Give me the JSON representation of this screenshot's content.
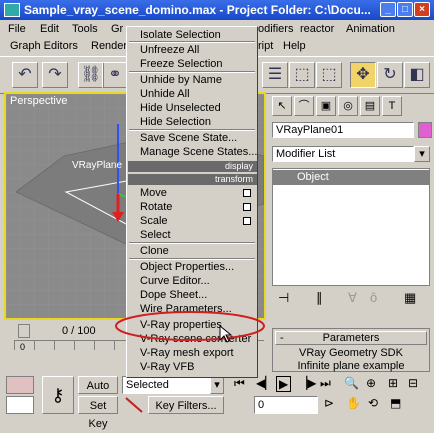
{
  "window": {
    "title": "Sample_vray_scene_domino.max   - Project Folder: C:\\Docu...",
    "minimize": "_",
    "maximize": "□",
    "close": "×"
  },
  "menubar1": [
    "File",
    "Edit",
    "Tools",
    "Gr",
    "odifiers",
    "reactor",
    "Animation"
  ],
  "menubar2": [
    "Graph Editors",
    "Render",
    "ript",
    "Help"
  ],
  "viewport": {
    "label": "Perspective",
    "object_label": "VRayPlane"
  },
  "context_menu": {
    "items_top": [
      "Isolate Selection",
      "Unfreeze All",
      "Freeze Selection"
    ],
    "items_mid": [
      "Unhide by Name",
      "Unhide All",
      "Hide Unselected",
      "Hide Selection"
    ],
    "items_scene": [
      "Save Scene State...",
      "Manage Scene States..."
    ],
    "header_display": "display",
    "header_transform": "transform",
    "transform_items": [
      "Move",
      "Rotate",
      "Scale",
      "Select"
    ],
    "clone": "Clone",
    "object_items": [
      "Object Properties...",
      "Curve Editor...",
      "Dope Sheet...",
      "Wire Parameters..."
    ],
    "vray_items": [
      "V-Ray properties",
      "V-Ray scene converter",
      "V-Ray mesh export",
      "V-Ray VFB"
    ]
  },
  "command_panel": {
    "object_name": "VRayPlane01",
    "modifier_list": "Modifier List",
    "stack_item": "Object",
    "rollout_title": "Parameters",
    "rollout_text1": "VRay Geometry SDK",
    "rollout_text2": "Infinite plane example",
    "rollout_toggle": "-"
  },
  "timeline": {
    "counter": "0 / 100",
    "tick_start": "0"
  },
  "bottom": {
    "auto_key": "Auto Key",
    "set_key": "Set Key",
    "selected": "Selected",
    "key_filters": "Key Filters...",
    "frame": "0"
  },
  "colors": {
    "title_bar": "#1848c8",
    "viewport_border": "#e8d820",
    "highlight_ring": "#d02020",
    "object_color_swatch": "#e060d0"
  }
}
